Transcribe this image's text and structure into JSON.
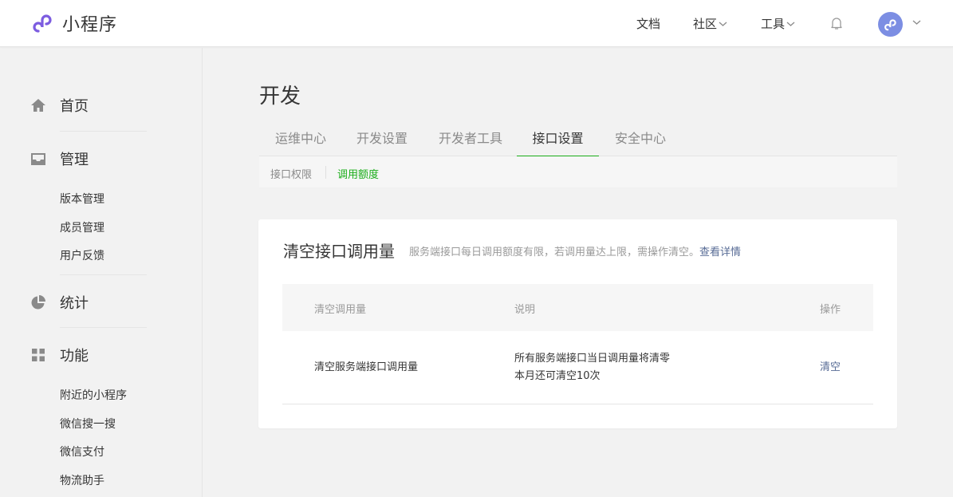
{
  "brand": {
    "name": "小程序",
    "accent": "#7c5ce0"
  },
  "topnav": {
    "docs": "文档",
    "community": "社区",
    "tools": "工具"
  },
  "sidebar": {
    "home": "首页",
    "manage": "管理",
    "manage_items": [
      "版本管理",
      "成员管理",
      "用户反馈"
    ],
    "stats": "统计",
    "features": "功能",
    "feature_items": [
      "附近的小程序",
      "微信搜一搜",
      "微信支付",
      "物流助手"
    ]
  },
  "main": {
    "title": "开发",
    "tabs": [
      {
        "label": "运维中心",
        "active": false
      },
      {
        "label": "开发设置",
        "active": false
      },
      {
        "label": "开发者工具",
        "active": false
      },
      {
        "label": "接口设置",
        "active": true
      },
      {
        "label": "安全中心",
        "active": false
      }
    ],
    "subtabs": [
      {
        "label": "接口权限",
        "active": false
      },
      {
        "label": "调用额度",
        "active": true
      }
    ],
    "card": {
      "title": "清空接口调用量",
      "desc": "服务端接口每日调用额度有限，若调用量达上限，需操作清空。",
      "desc_link": "查看详情",
      "table": {
        "headers": [
          "清空调用量",
          "说明",
          "操作"
        ],
        "rows": [
          {
            "name": "清空服务端接口调用量",
            "desc_line1": "所有服务端接口当日调用量将清零",
            "desc_line2": "本月还可清空10次",
            "action": "清空"
          }
        ]
      }
    }
  },
  "colors": {
    "active_green": "#1aad19",
    "link_blue": "#576b95"
  }
}
